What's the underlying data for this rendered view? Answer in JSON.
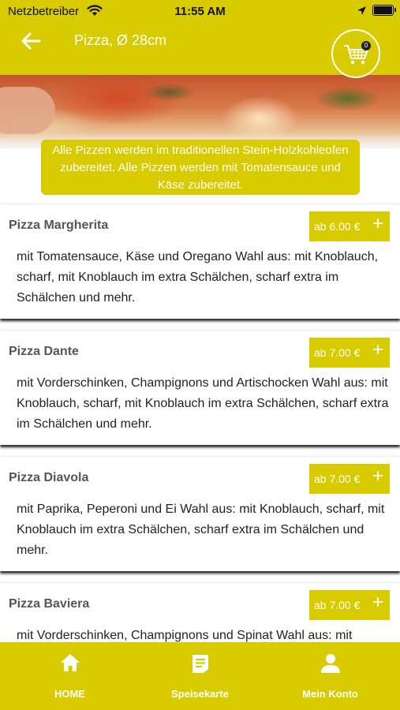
{
  "status_bar": {
    "carrier": "Netzbetreiber",
    "time": "11:55 AM"
  },
  "header": {
    "title": "Pizza, Ø 28cm",
    "cart_count": "0"
  },
  "banner": {
    "text": "Alle Pizzen werden im traditionellen Stein-Holzkohleofen zubereitet. Alle Pizzen werden mit Tomatensauce und Käse zubereitet."
  },
  "menu_items": [
    {
      "name": "Pizza Margherita",
      "price": "ab 6.00 €",
      "description": "mit Tomatensauce, Käse und Oregano Wahl aus: mit Knoblauch, scharf, mit Knoblauch im extra Schälchen, scharf extra im Schälchen und mehr."
    },
    {
      "name": "Pizza Dante",
      "price": "ab 7.00 €",
      "description": "mit Vorderschinken, Champignons und Artischocken Wahl aus: mit Knoblauch, scharf, mit Knoblauch im extra Schälchen, scharf extra im Schälchen und mehr."
    },
    {
      "name": "Pizza Diavola",
      "price": "ab 7.00 €",
      "description": "mit Paprika, Peperoni und Ei Wahl aus: mit Knoblauch, scharf, mit Knoblauch im extra Schälchen, scharf extra im Schälchen und mehr."
    },
    {
      "name": "Pizza Baviera",
      "price": "ab 7.00 €",
      "description": "mit Vorderschinken, Champignons und Spinat Wahl aus: mit Knoblauch, scharf, mit Knoblauch im extra Schälchen, scharf extra im Schälchen und mehr."
    }
  ],
  "tab_bar": {
    "home": "HOME",
    "menu": "Speisekarte",
    "account": "Mein Konto"
  },
  "colors": {
    "accent": "#d8cc00",
    "text": "#222222",
    "muted": "#555555"
  }
}
